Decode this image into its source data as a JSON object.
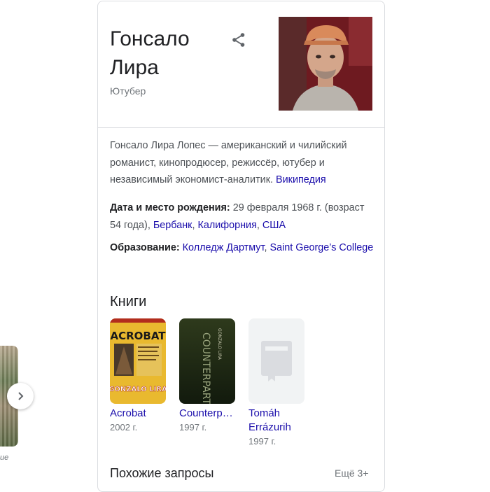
{
  "left_carousel": {
    "caption": "ие"
  },
  "panel": {
    "title": "Гонсало Лира",
    "subtitle": "Ютубер",
    "description": "Гонсало Лира Лопес — американский и чилийский романист, кинопродюсер, режиссёр, ютубер и независимый экономист-аналитик.",
    "wiki_link": "Википедия",
    "birth": {
      "label": "Дата и место рождения:",
      "text": "29 февраля 1968 г. (возраст 54 года),",
      "links": [
        "Бербанк",
        "Калифорния",
        "США"
      ]
    },
    "education": {
      "label": "Образование:",
      "links": [
        "Колледж Дартмут",
        "Saint George’s College"
      ]
    },
    "books_heading": "Книги",
    "books": [
      {
        "title": "Acrobat",
        "year": "2002 г.",
        "cover_text": "ACROBAT",
        "cover_author": "GONZALO LIRA"
      },
      {
        "title": "Counterp…",
        "year": "1997 г.",
        "cover_text": "COUNTERPARTS",
        "cover_author": "GONZALO LIRA"
      },
      {
        "title": "Tomáh Errázurih",
        "year": "1997 г."
      }
    ],
    "related_heading": "Похожие запросы",
    "more_label": "Ещё 3+"
  },
  "colors": {
    "link": "#1a0dab",
    "muted": "#70757a",
    "border": "#dadce0"
  }
}
